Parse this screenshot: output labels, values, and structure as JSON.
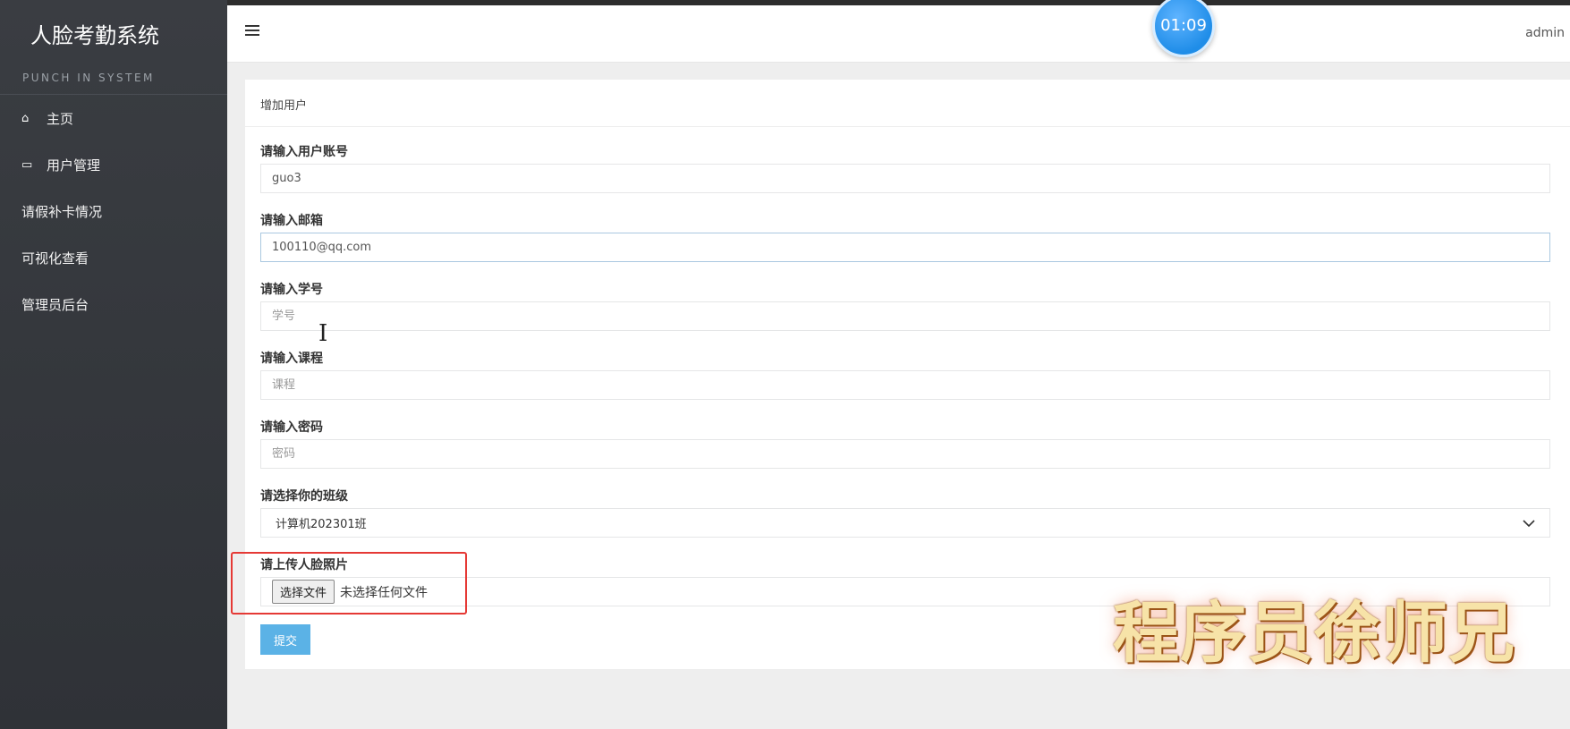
{
  "sidebar": {
    "brand": "人脸考勤系统",
    "subtitle": "PUNCH IN SYSTEM",
    "items": [
      {
        "label": "主页",
        "icon": "home-icon"
      },
      {
        "label": "用户管理",
        "icon": "laptop-icon"
      },
      {
        "label": "请假补卡情况",
        "icon": ""
      },
      {
        "label": "可视化查看",
        "icon": ""
      },
      {
        "label": "管理员后台",
        "icon": ""
      }
    ]
  },
  "header": {
    "toggle_icon": "menu-toggle-icon",
    "user": "admin",
    "timer": "01:09"
  },
  "form": {
    "heading": "增加用户",
    "account_label": "请输入用户账号",
    "account_value": "guo3",
    "email_label": "请输入邮箱",
    "email_value": "100110@qq.com",
    "student_id_label": "请输入学号",
    "student_id_placeholder": "学号",
    "course_label": "请输入课程",
    "course_placeholder": "课程",
    "password_label": "请输入密码",
    "password_placeholder": "密码",
    "class_label": "请选择你的班级",
    "class_selected": "计算机202301班",
    "photo_label": "请上传人脸照片",
    "file_button": "选择文件",
    "file_status": "未选择任何文件",
    "submit_label": "提交"
  },
  "overlay": {
    "watermark": "程序员徐师兄",
    "highlight_color": "#e53935"
  }
}
